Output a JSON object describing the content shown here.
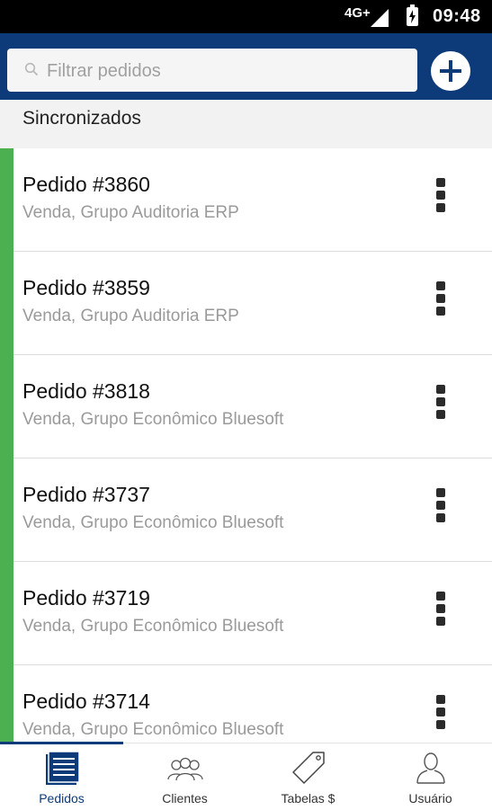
{
  "status_bar": {
    "network": "4G+",
    "time": "09:48"
  },
  "search": {
    "placeholder": "Filtrar pedidos",
    "value": ""
  },
  "section": {
    "title": "Sincronizados"
  },
  "colors": {
    "primary": "#0d3a78",
    "synced": "#4cb050"
  },
  "orders": [
    {
      "title": "Pedido #3860",
      "subtitle": "Venda, Grupo Auditoria ERP"
    },
    {
      "title": "Pedido #3859",
      "subtitle": "Venda, Grupo Auditoria ERP"
    },
    {
      "title": "Pedido #3818",
      "subtitle": "Venda, Grupo Econômico Bluesoft"
    },
    {
      "title": "Pedido #3737",
      "subtitle": "Venda, Grupo Econômico Bluesoft"
    },
    {
      "title": "Pedido #3719",
      "subtitle": "Venda, Grupo Econômico Bluesoft"
    },
    {
      "title": "Pedido #3714",
      "subtitle": "Venda, Grupo Econômico Bluesoft"
    }
  ],
  "bottom_nav": [
    {
      "label": "Pedidos",
      "icon": "document-list-icon",
      "active": true
    },
    {
      "label": "Clientes",
      "icon": "users-icon",
      "active": false
    },
    {
      "label": "Tabelas $",
      "icon": "price-tag-icon",
      "active": false
    },
    {
      "label": "Usuário",
      "icon": "user-icon",
      "active": false
    }
  ]
}
